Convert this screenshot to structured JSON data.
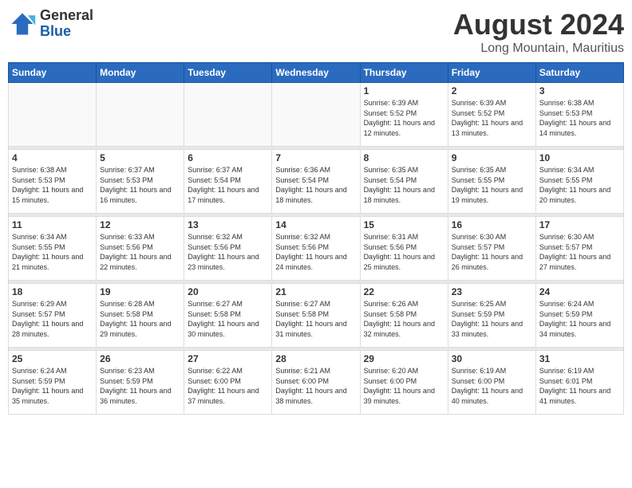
{
  "header": {
    "logo_general": "General",
    "logo_blue": "Blue",
    "title": "August 2024",
    "location": "Long Mountain, Mauritius"
  },
  "days_of_week": [
    "Sunday",
    "Monday",
    "Tuesday",
    "Wednesday",
    "Thursday",
    "Friday",
    "Saturday"
  ],
  "weeks": [
    [
      {
        "day": "",
        "info": ""
      },
      {
        "day": "",
        "info": ""
      },
      {
        "day": "",
        "info": ""
      },
      {
        "day": "",
        "info": ""
      },
      {
        "day": "1",
        "info": "Sunrise: 6:39 AM\nSunset: 5:52 PM\nDaylight: 11 hours and 12 minutes."
      },
      {
        "day": "2",
        "info": "Sunrise: 6:39 AM\nSunset: 5:52 PM\nDaylight: 11 hours and 13 minutes."
      },
      {
        "day": "3",
        "info": "Sunrise: 6:38 AM\nSunset: 5:53 PM\nDaylight: 11 hours and 14 minutes."
      }
    ],
    [
      {
        "day": "4",
        "info": "Sunrise: 6:38 AM\nSunset: 5:53 PM\nDaylight: 11 hours and 15 minutes."
      },
      {
        "day": "5",
        "info": "Sunrise: 6:37 AM\nSunset: 5:53 PM\nDaylight: 11 hours and 16 minutes."
      },
      {
        "day": "6",
        "info": "Sunrise: 6:37 AM\nSunset: 5:54 PM\nDaylight: 11 hours and 17 minutes."
      },
      {
        "day": "7",
        "info": "Sunrise: 6:36 AM\nSunset: 5:54 PM\nDaylight: 11 hours and 18 minutes."
      },
      {
        "day": "8",
        "info": "Sunrise: 6:35 AM\nSunset: 5:54 PM\nDaylight: 11 hours and 18 minutes."
      },
      {
        "day": "9",
        "info": "Sunrise: 6:35 AM\nSunset: 5:55 PM\nDaylight: 11 hours and 19 minutes."
      },
      {
        "day": "10",
        "info": "Sunrise: 6:34 AM\nSunset: 5:55 PM\nDaylight: 11 hours and 20 minutes."
      }
    ],
    [
      {
        "day": "11",
        "info": "Sunrise: 6:34 AM\nSunset: 5:55 PM\nDaylight: 11 hours and 21 minutes."
      },
      {
        "day": "12",
        "info": "Sunrise: 6:33 AM\nSunset: 5:56 PM\nDaylight: 11 hours and 22 minutes."
      },
      {
        "day": "13",
        "info": "Sunrise: 6:32 AM\nSunset: 5:56 PM\nDaylight: 11 hours and 23 minutes."
      },
      {
        "day": "14",
        "info": "Sunrise: 6:32 AM\nSunset: 5:56 PM\nDaylight: 11 hours and 24 minutes."
      },
      {
        "day": "15",
        "info": "Sunrise: 6:31 AM\nSunset: 5:56 PM\nDaylight: 11 hours and 25 minutes."
      },
      {
        "day": "16",
        "info": "Sunrise: 6:30 AM\nSunset: 5:57 PM\nDaylight: 11 hours and 26 minutes."
      },
      {
        "day": "17",
        "info": "Sunrise: 6:30 AM\nSunset: 5:57 PM\nDaylight: 11 hours and 27 minutes."
      }
    ],
    [
      {
        "day": "18",
        "info": "Sunrise: 6:29 AM\nSunset: 5:57 PM\nDaylight: 11 hours and 28 minutes."
      },
      {
        "day": "19",
        "info": "Sunrise: 6:28 AM\nSunset: 5:58 PM\nDaylight: 11 hours and 29 minutes."
      },
      {
        "day": "20",
        "info": "Sunrise: 6:27 AM\nSunset: 5:58 PM\nDaylight: 11 hours and 30 minutes."
      },
      {
        "day": "21",
        "info": "Sunrise: 6:27 AM\nSunset: 5:58 PM\nDaylight: 11 hours and 31 minutes."
      },
      {
        "day": "22",
        "info": "Sunrise: 6:26 AM\nSunset: 5:58 PM\nDaylight: 11 hours and 32 minutes."
      },
      {
        "day": "23",
        "info": "Sunrise: 6:25 AM\nSunset: 5:59 PM\nDaylight: 11 hours and 33 minutes."
      },
      {
        "day": "24",
        "info": "Sunrise: 6:24 AM\nSunset: 5:59 PM\nDaylight: 11 hours and 34 minutes."
      }
    ],
    [
      {
        "day": "25",
        "info": "Sunrise: 6:24 AM\nSunset: 5:59 PM\nDaylight: 11 hours and 35 minutes."
      },
      {
        "day": "26",
        "info": "Sunrise: 6:23 AM\nSunset: 5:59 PM\nDaylight: 11 hours and 36 minutes."
      },
      {
        "day": "27",
        "info": "Sunrise: 6:22 AM\nSunset: 6:00 PM\nDaylight: 11 hours and 37 minutes."
      },
      {
        "day": "28",
        "info": "Sunrise: 6:21 AM\nSunset: 6:00 PM\nDaylight: 11 hours and 38 minutes."
      },
      {
        "day": "29",
        "info": "Sunrise: 6:20 AM\nSunset: 6:00 PM\nDaylight: 11 hours and 39 minutes."
      },
      {
        "day": "30",
        "info": "Sunrise: 6:19 AM\nSunset: 6:00 PM\nDaylight: 11 hours and 40 minutes."
      },
      {
        "day": "31",
        "info": "Sunrise: 6:19 AM\nSunset: 6:01 PM\nDaylight: 11 hours and 41 minutes."
      }
    ]
  ]
}
